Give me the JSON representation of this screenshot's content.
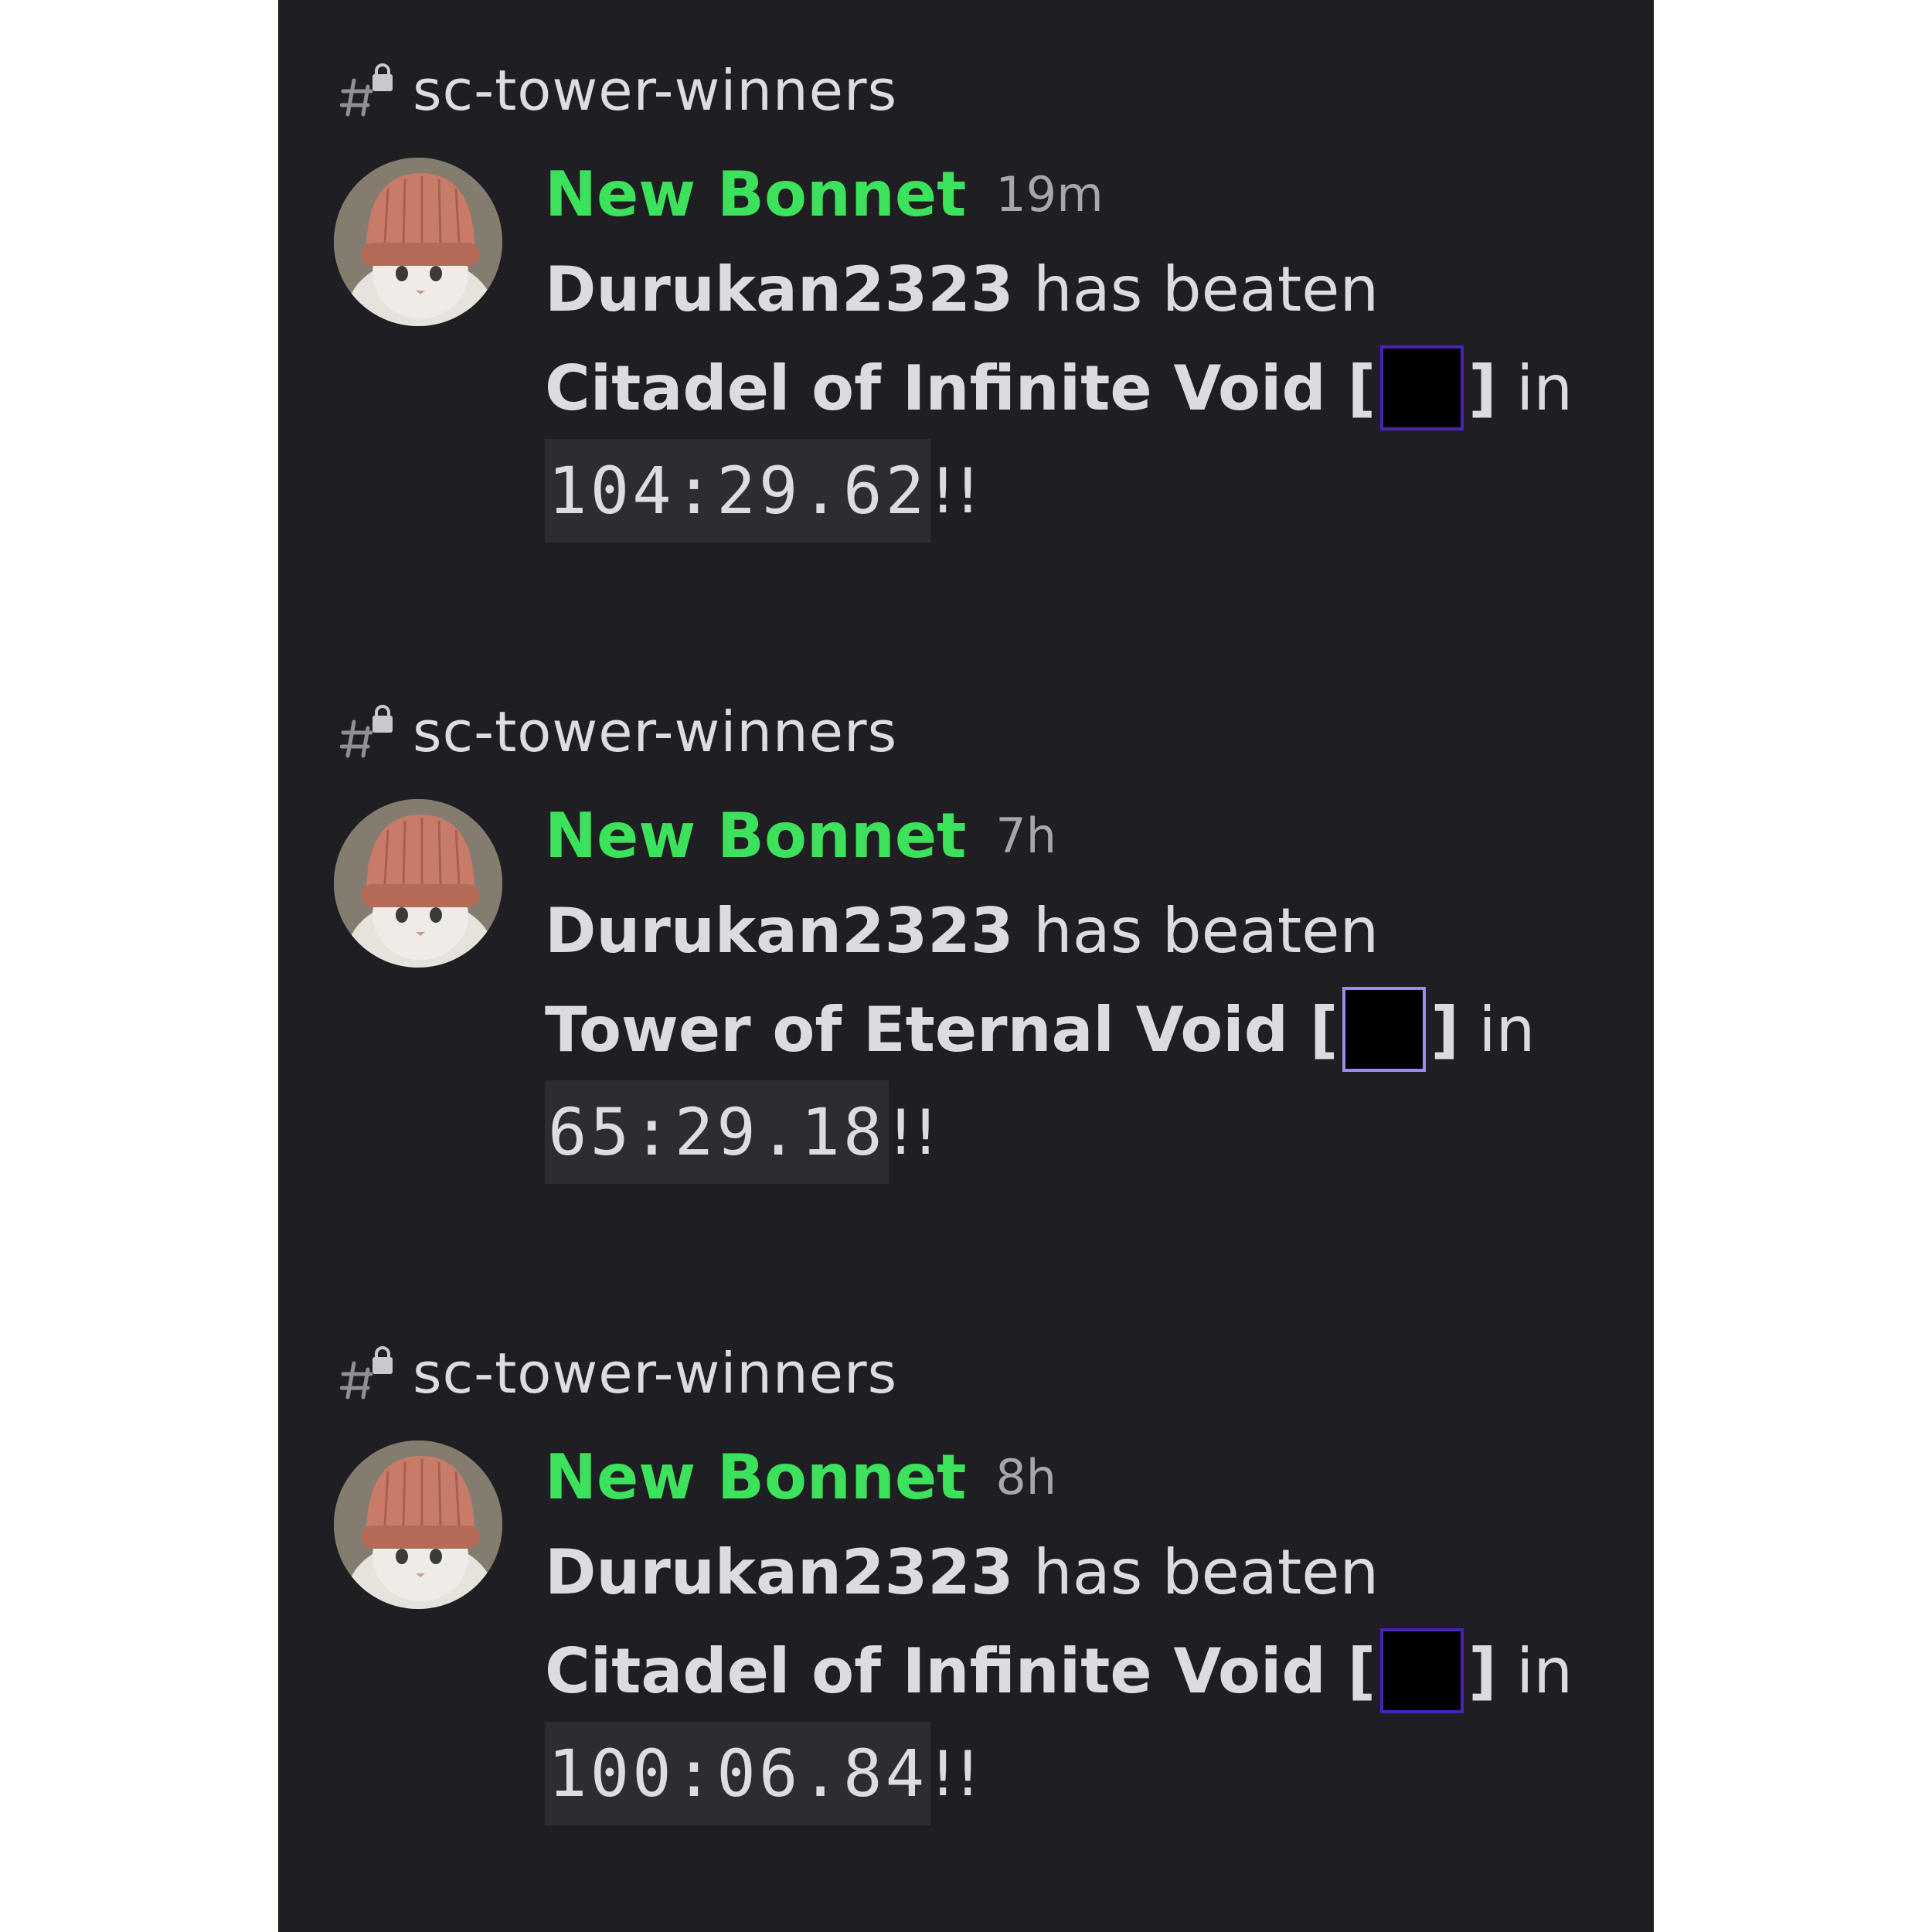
{
  "colors": {
    "panel_bg": "#1f1f23",
    "author": "#3ce25b",
    "text": "#dbdcdf",
    "timestamp": "#a5a7ad",
    "code_bg": "#2c2d33",
    "box_border_dark": "#4a22b8",
    "box_border_light": "#9a8cf0"
  },
  "messages": [
    {
      "channel": "sc-tower-winners",
      "channel_icon": "locked-hash-icon",
      "author": "New Bonnet",
      "timestamp": "19m",
      "player": "Durukan2323",
      "verb": "has beaten",
      "tower": "Citadel of Infinite Void",
      "open_bracket": "[",
      "close_bracket": "]",
      "in": "in",
      "time": "104:29.62",
      "suffix": "!!"
    },
    {
      "channel": "sc-tower-winners",
      "channel_icon": "locked-hash-icon",
      "author": "New Bonnet",
      "timestamp": "7h",
      "player": "Durukan2323",
      "verb": "has beaten",
      "tower": "Tower of Eternal Void",
      "open_bracket": "[",
      "close_bracket": "]",
      "in": "in",
      "time": "65:29.18",
      "suffix": "!!"
    },
    {
      "channel": "sc-tower-winners",
      "channel_icon": "locked-hash-icon",
      "author": "New Bonnet",
      "timestamp": "8h",
      "player": "Durukan2323",
      "verb": "has beaten",
      "tower": "Citadel of Infinite Void",
      "open_bracket": "[",
      "close_bracket": "]",
      "in": "in",
      "time": "100:06.84",
      "suffix": "!!"
    }
  ]
}
